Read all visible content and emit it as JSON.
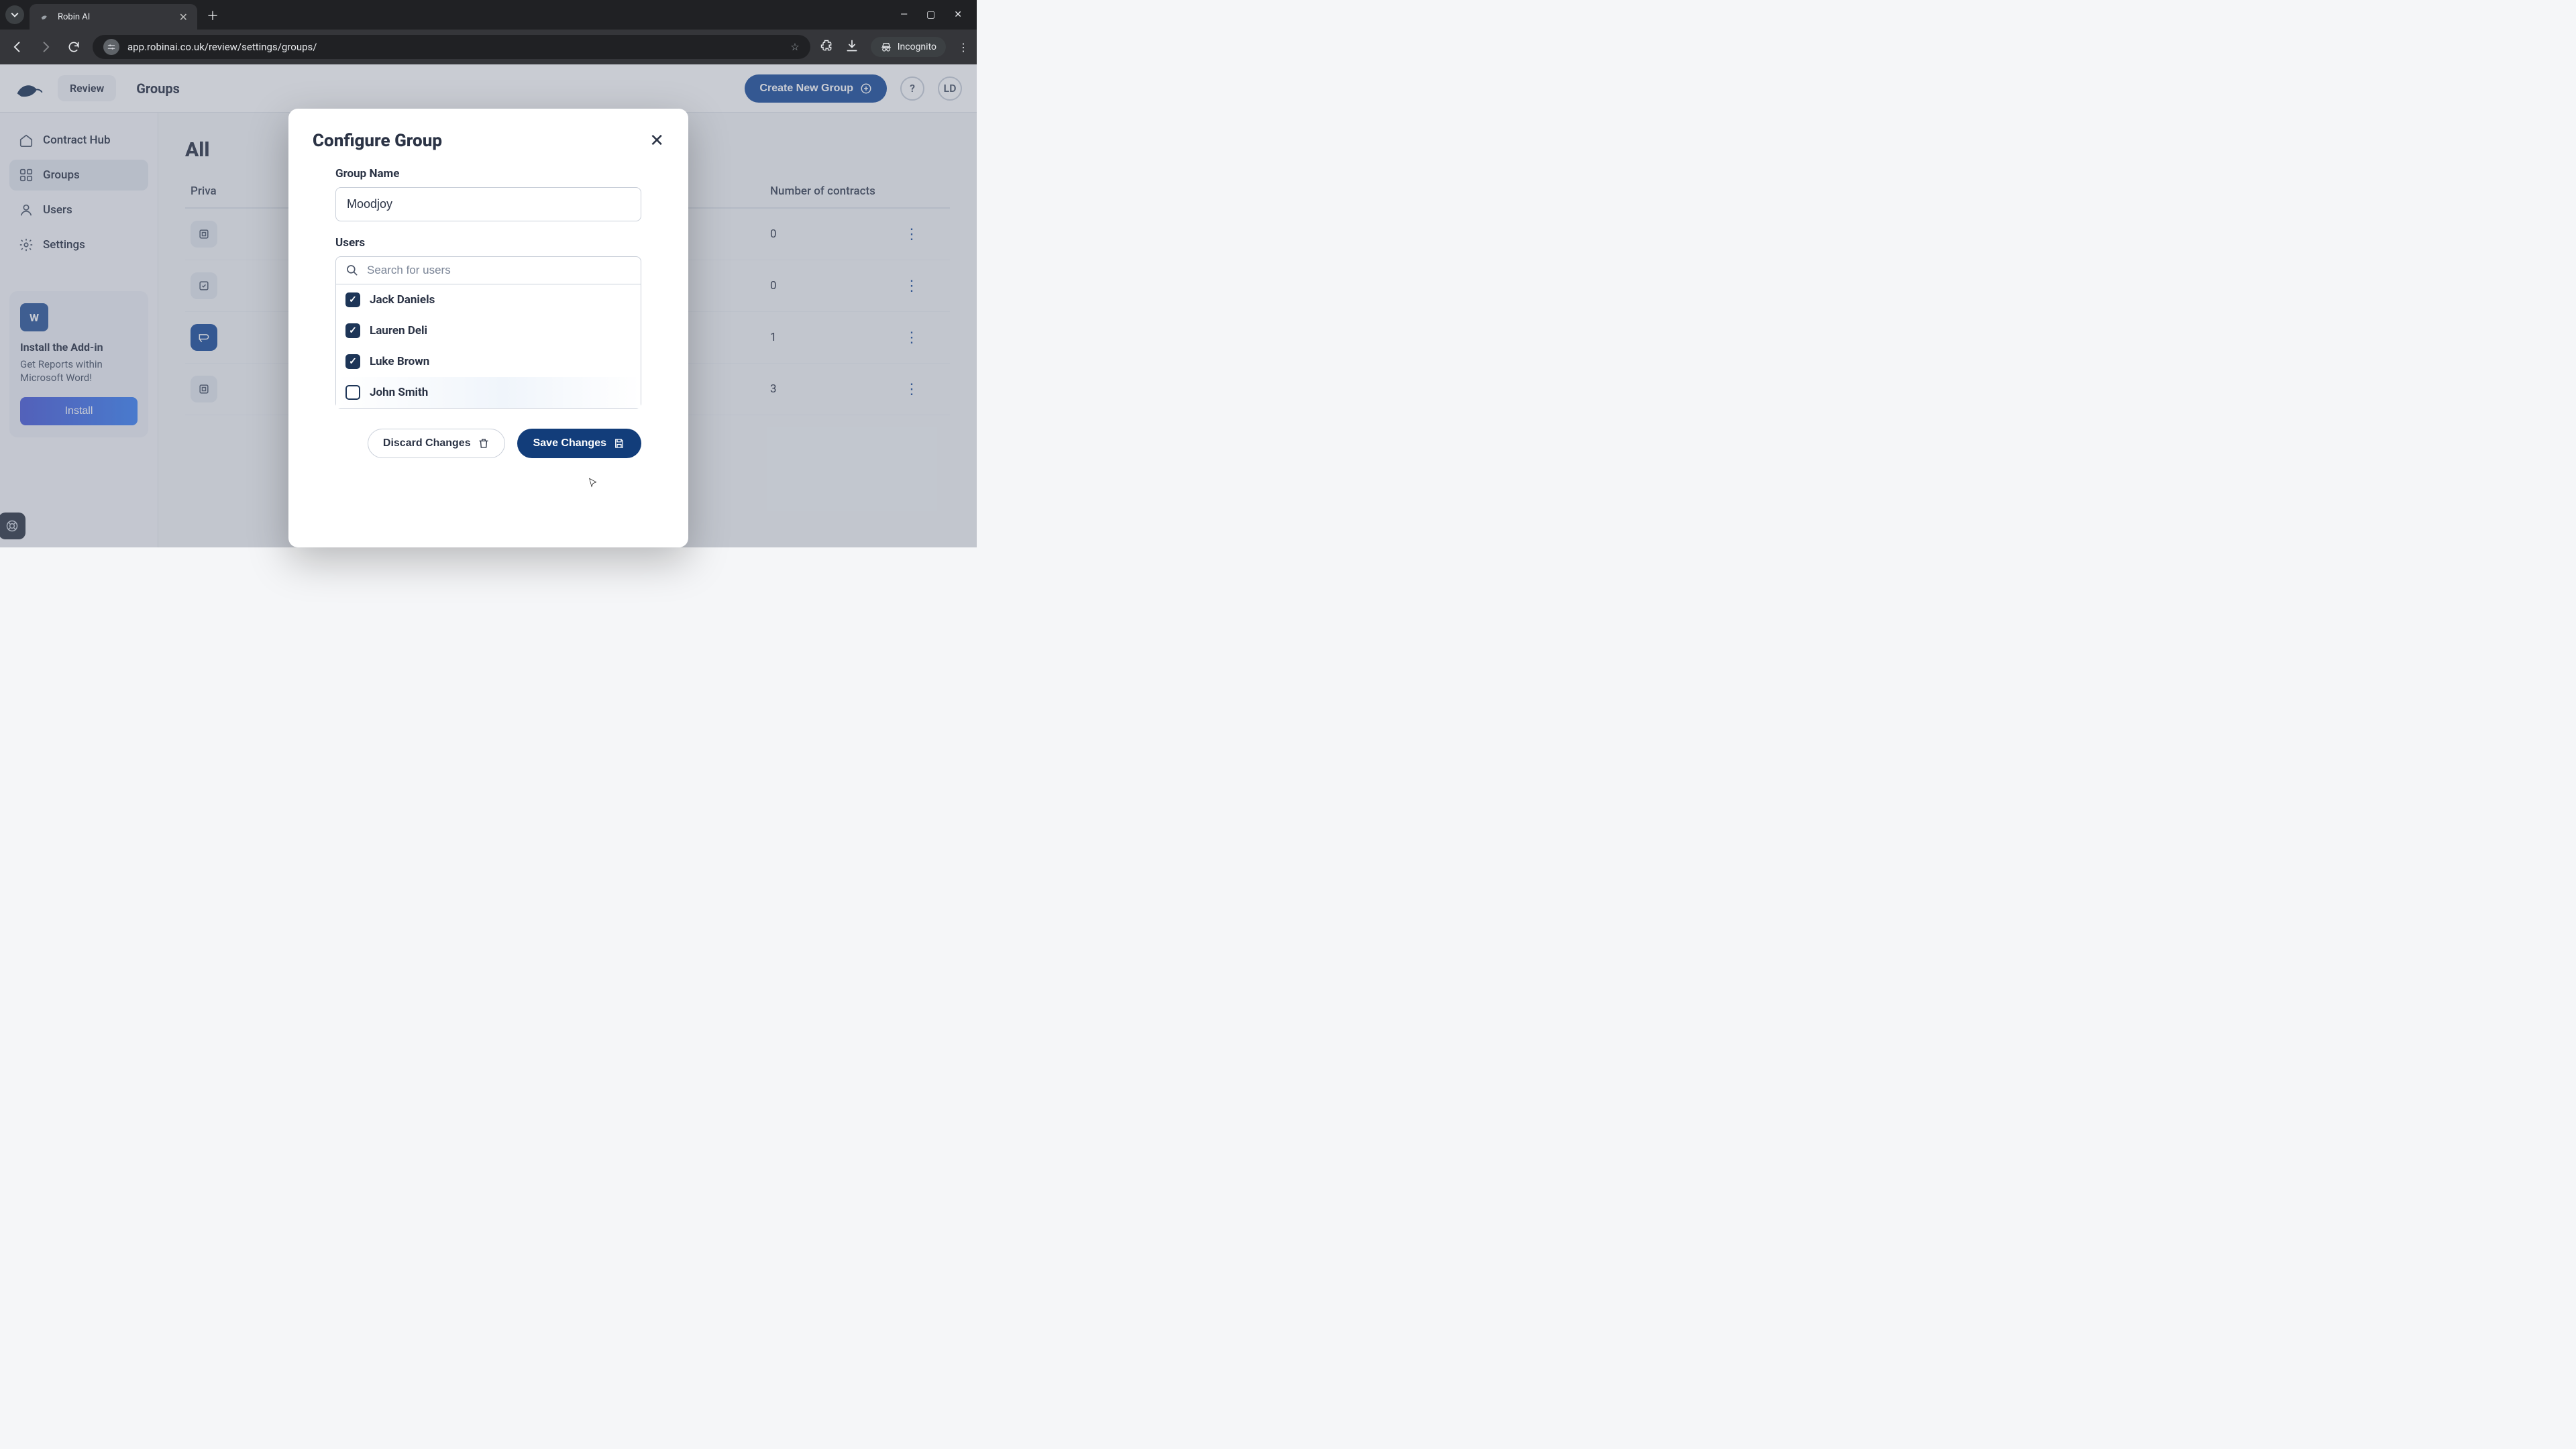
{
  "browser": {
    "tab_title": "Robin AI",
    "url": "app.robinai.co.uk/review/settings/groups/",
    "incognito_label": "Incognito"
  },
  "header": {
    "review_label": "Review",
    "page_title": "Groups",
    "create_button": "Create New Group",
    "avatar_initials": "LD"
  },
  "sidebar": {
    "items": [
      {
        "label": "Contract Hub",
        "icon": "home-icon"
      },
      {
        "label": "Groups",
        "icon": "grid-icon"
      },
      {
        "label": "Users",
        "icon": "user-icon"
      },
      {
        "label": "Settings",
        "icon": "gear-icon"
      }
    ],
    "addin": {
      "title": "Install the Add-in",
      "subtitle": "Get Reports within Microsoft Word!",
      "button": "Install",
      "word_badge": "W"
    }
  },
  "main": {
    "heading": "All",
    "columns": {
      "privacy": "Priva",
      "name": "",
      "contracts": "Number of contracts"
    },
    "rows": [
      {
        "contracts": "0"
      },
      {
        "contracts": "0"
      },
      {
        "contracts": "1"
      },
      {
        "contracts": "3"
      }
    ]
  },
  "modal": {
    "title": "Configure Group",
    "group_name_label": "Group Name",
    "group_name_value": "Moodjoy",
    "users_label": "Users",
    "search_placeholder": "Search for users",
    "users": [
      {
        "name": "Jack Daniels",
        "checked": true
      },
      {
        "name": "Lauren Deli",
        "checked": true
      },
      {
        "name": "Luke Brown",
        "checked": true
      },
      {
        "name": "John Smith",
        "checked": false
      }
    ],
    "discard_label": "Discard Changes",
    "save_label": "Save Changes"
  }
}
